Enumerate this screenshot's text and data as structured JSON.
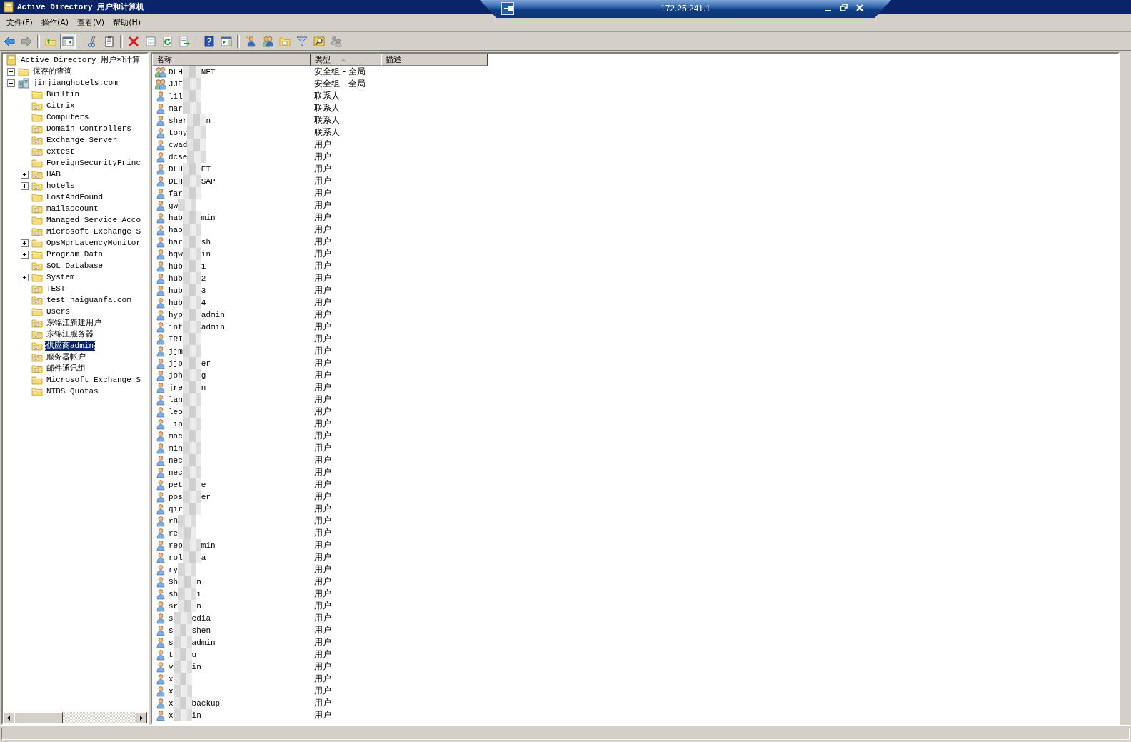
{
  "window": {
    "title": "Active Directory 用户和计算机"
  },
  "remote_bar": {
    "address": "172.25.241.1"
  },
  "menu": [
    {
      "label": "文件(F)"
    },
    {
      "label": "操作(A)"
    },
    {
      "label": "查看(V)"
    },
    {
      "label": "帮助(H)"
    }
  ],
  "toolbar": [
    [
      {
        "kind": "back",
        "pressed": false
      },
      {
        "kind": "forward",
        "pressed": false
      }
    ],
    [
      {
        "kind": "up",
        "pressed": false
      },
      {
        "kind": "tree",
        "pressed": true
      }
    ],
    [
      {
        "kind": "cut",
        "pressed": false
      },
      {
        "kind": "paste",
        "pressed": false
      }
    ],
    [
      {
        "kind": "delete",
        "pressed": false
      },
      {
        "kind": "properties",
        "pressed": false
      },
      {
        "kind": "refresh",
        "pressed": false
      },
      {
        "kind": "export",
        "pressed": false
      }
    ],
    [
      {
        "kind": "help",
        "pressed": false
      },
      {
        "kind": "window",
        "pressed": false
      }
    ],
    [
      {
        "kind": "user_add",
        "pressed": false
      },
      {
        "kind": "group_add",
        "pressed": false
      },
      {
        "kind": "ou_add",
        "pressed": false
      },
      {
        "kind": "filter",
        "pressed": false
      },
      {
        "kind": "find",
        "pressed": false
      },
      {
        "kind": "delegate",
        "pressed": false
      }
    ]
  ],
  "tree": {
    "items": [
      {
        "label": "Active Directory 用户和计算",
        "kind": "console",
        "selected": false,
        "children": [
          {
            "label": "保存的查询",
            "kind": "folder",
            "expanded": false,
            "selected": false
          },
          {
            "label": "jinjianghotels.com",
            "kind": "domain",
            "expanded": true,
            "selected": false,
            "children": [
              {
                "label": "Builtin",
                "kind": "folder",
                "selected": false
              },
              {
                "label": "Citrix",
                "kind": "ou",
                "selected": false
              },
              {
                "label": "Computers",
                "kind": "folder",
                "selected": false
              },
              {
                "label": "Domain Controllers",
                "kind": "ou",
                "selected": false
              },
              {
                "label": "Exchange Server",
                "kind": "ou",
                "selected": false
              },
              {
                "label": "extest",
                "kind": "ou",
                "selected": false
              },
              {
                "label": "ForeignSecurityPrinc",
                "kind": "folder",
                "selected": false
              },
              {
                "label": "HAB",
                "kind": "ou",
                "expanded": false,
                "selected": false
              },
              {
                "label": "hotels",
                "kind": "ou",
                "expanded": false,
                "selected": false
              },
              {
                "label": "LostAndFound",
                "kind": "folder",
                "selected": false
              },
              {
                "label": "mailaccount",
                "kind": "ou",
                "selected": false
              },
              {
                "label": "Managed Service Acco",
                "kind": "folder",
                "selected": false
              },
              {
                "label": "Microsoft Exchange S",
                "kind": "ou",
                "selected": false
              },
              {
                "label": "OpsMgrLatencyMonitor",
                "kind": "folder",
                "expanded": false,
                "selected": false
              },
              {
                "label": "Program Data",
                "kind": "folder",
                "expanded": false,
                "selected": false
              },
              {
                "label": "SQL Database",
                "kind": "ou",
                "selected": false
              },
              {
                "label": "System",
                "kind": "folder",
                "expanded": false,
                "selected": false
              },
              {
                "label": "TEST",
                "kind": "ou",
                "selected": false
              },
              {
                "label": "test haiguanfa.com",
                "kind": "ou",
                "selected": false
              },
              {
                "label": "Users",
                "kind": "folder",
                "selected": false
              },
              {
                "label": "东锦江新建用户",
                "kind": "ou",
                "selected": false
              },
              {
                "label": "东锦江服务器",
                "kind": "ou",
                "selected": false
              },
              {
                "label": "供应商admin",
                "kind": "ou",
                "selected": true
              },
              {
                "label": "服务器帐户",
                "kind": "ou",
                "selected": false
              },
              {
                "label": "邮件通讯组",
                "kind": "ou",
                "selected": false
              },
              {
                "label": "Microsoft Exchange S",
                "kind": "folder",
                "selected": false
              },
              {
                "label": "NTDS Quotas",
                "kind": "folder",
                "selected": false
              }
            ]
          }
        ]
      }
    ]
  },
  "list": {
    "columns": [
      {
        "label": "名称",
        "sorted": false
      },
      {
        "label": "类型",
        "sorted": true
      },
      {
        "label": "描述",
        "sorted": false
      }
    ],
    "rows": [
      {
        "kind": "group",
        "name_start": "DLH",
        "name_end": "NET",
        "type": "安全组 - 全局"
      },
      {
        "kind": "group",
        "name_start": "JJE",
        "type": "安全组 - 全局"
      },
      {
        "kind": "person",
        "name_start": "lil",
        "type": "联系人"
      },
      {
        "kind": "person",
        "name_start": "mar",
        "type": "联系人"
      },
      {
        "kind": "person",
        "name_start": "sher",
        "name_end": "n",
        "type": "联系人"
      },
      {
        "kind": "person",
        "name_start": "tony",
        "type": "联系人"
      },
      {
        "kind": "person",
        "name_start": "cwad",
        "type": "用户"
      },
      {
        "kind": "person",
        "name_start": "dcse",
        "type": "用户"
      },
      {
        "kind": "person",
        "name_start": "DLH",
        "name_end": "ET",
        "type": "用户"
      },
      {
        "kind": "person",
        "name_start": "DLH",
        "name_end": "SAP",
        "type": "用户"
      },
      {
        "kind": "person",
        "name_start": "far",
        "type": "用户"
      },
      {
        "kind": "person",
        "name_start": "gw",
        "type": "用户"
      },
      {
        "kind": "person",
        "name_start": "hab",
        "name_end": "min",
        "type": "用户"
      },
      {
        "kind": "person",
        "name_start": "hao",
        "type": "用户"
      },
      {
        "kind": "person",
        "name_start": "har",
        "name_end": "sh",
        "type": "用户"
      },
      {
        "kind": "person",
        "name_start": "hqw",
        "name_end": "in",
        "type": "用户"
      },
      {
        "kind": "person",
        "name_start": "hub",
        "name_end": "1",
        "type": "用户"
      },
      {
        "kind": "person",
        "name_start": "hub",
        "name_end": "2",
        "type": "用户"
      },
      {
        "kind": "person",
        "name_start": "hub",
        "name_end": "3",
        "type": "用户"
      },
      {
        "kind": "person",
        "name_start": "hub",
        "name_end": "4",
        "type": "用户"
      },
      {
        "kind": "person",
        "name_start": "hyp",
        "name_end": "admin",
        "type": "用户"
      },
      {
        "kind": "person",
        "name_start": "int",
        "name_end": "admin",
        "type": "用户"
      },
      {
        "kind": "person",
        "name_start": "IRI",
        "type": "用户"
      },
      {
        "kind": "person",
        "name_start": "jjm",
        "type": "用户"
      },
      {
        "kind": "person",
        "name_start": "jjp",
        "name_end": "er",
        "type": "用户"
      },
      {
        "kind": "person",
        "name_start": "joh",
        "name_end": "g",
        "type": "用户"
      },
      {
        "kind": "person",
        "name_start": "jre",
        "name_end": "n",
        "type": "用户"
      },
      {
        "kind": "person",
        "name_start": "lan",
        "type": "用户"
      },
      {
        "kind": "person",
        "name_start": "leo",
        "type": "用户"
      },
      {
        "kind": "person",
        "name_start": "lin",
        "type": "用户"
      },
      {
        "kind": "person",
        "name_start": "mac",
        "type": "用户"
      },
      {
        "kind": "person",
        "name_start": "min",
        "type": "用户"
      },
      {
        "kind": "person",
        "name_start": "nec",
        "type": "用户"
      },
      {
        "kind": "person",
        "name_start": "nec",
        "type": "用户"
      },
      {
        "kind": "person",
        "name_start": "pet",
        "name_end": "e",
        "type": "用户"
      },
      {
        "kind": "person",
        "name_start": "pos",
        "name_end": "er",
        "type": "用户"
      },
      {
        "kind": "person",
        "name_start": "qir",
        "type": "用户"
      },
      {
        "kind": "person",
        "name_start": "r8",
        "type": "用户"
      },
      {
        "kind": "person",
        "name_start": "re",
        "type": "用户"
      },
      {
        "kind": "person",
        "name_start": "rep",
        "name_end": "min",
        "type": "用户"
      },
      {
        "kind": "person",
        "name_start": "rol",
        "name_end": "a",
        "type": "用户"
      },
      {
        "kind": "person",
        "name_start": "ry",
        "type": "用户"
      },
      {
        "kind": "person",
        "name_start": "Sh",
        "name_end": "n",
        "type": "用户"
      },
      {
        "kind": "person",
        "name_start": "sh",
        "name_end": "i",
        "type": "用户"
      },
      {
        "kind": "person",
        "name_start": "sr",
        "name_end": "n",
        "type": "用户"
      },
      {
        "kind": "person",
        "name_start": "s",
        "name_end": "edia",
        "type": "用户"
      },
      {
        "kind": "person",
        "name_start": "s",
        "name_end": "shen",
        "type": "用户"
      },
      {
        "kind": "person",
        "name_start": "s",
        "name_end": "admin",
        "type": "用户"
      },
      {
        "kind": "person",
        "name_start": "t",
        "name_end": "u",
        "type": "用户"
      },
      {
        "kind": "person",
        "name_start": "v",
        "name_end": "in",
        "type": "用户"
      },
      {
        "kind": "person",
        "name_start": "x",
        "type": "用户"
      },
      {
        "kind": "person",
        "name_start": "x",
        "type": "用户"
      },
      {
        "kind": "person",
        "name_start": "x",
        "name_end": "backup",
        "type": "用户"
      },
      {
        "kind": "person",
        "name_start": "x",
        "name_end": "in",
        "type": "用户"
      }
    ]
  }
}
